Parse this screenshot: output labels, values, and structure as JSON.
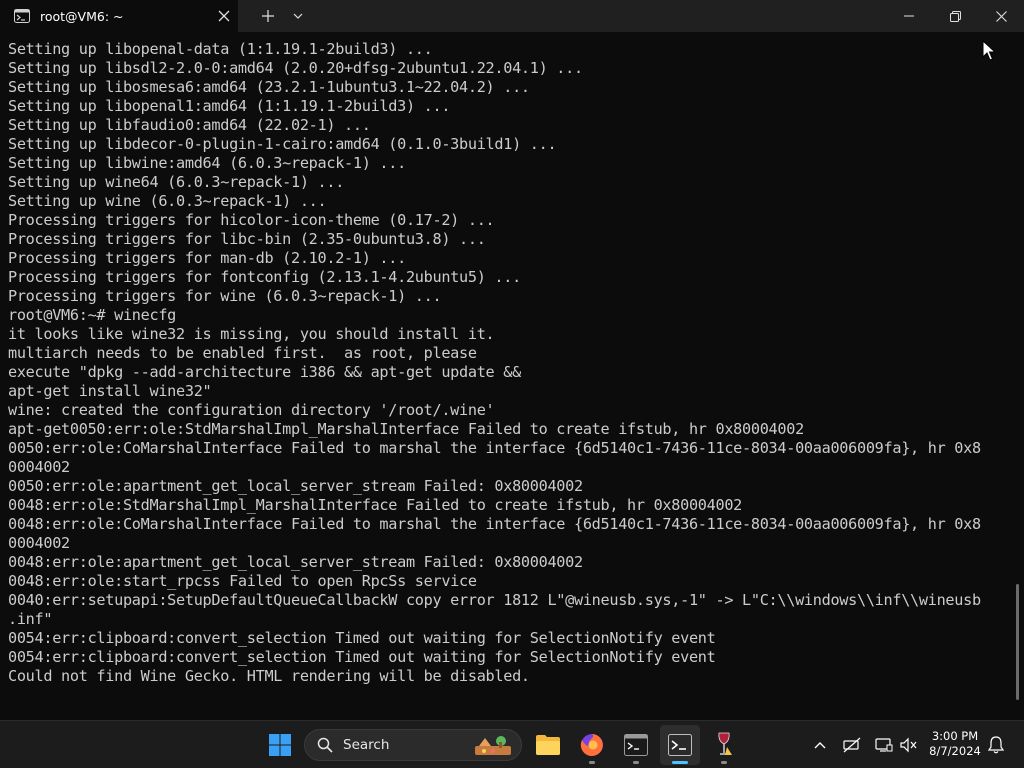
{
  "window": {
    "tab_title": "root@VM6: ~"
  },
  "terminal": {
    "lines": [
      "Setting up libopenal-data (1:1.19.1-2build3) ...",
      "Setting up libsdl2-2.0-0:amd64 (2.0.20+dfsg-2ubuntu1.22.04.1) ...",
      "Setting up libosmesa6:amd64 (23.2.1-1ubuntu3.1~22.04.2) ...",
      "Setting up libopenal1:amd64 (1:1.19.1-2build3) ...",
      "Setting up libfaudio0:amd64 (22.02-1) ...",
      "Setting up libdecor-0-plugin-1-cairo:amd64 (0.1.0-3build1) ...",
      "Setting up libwine:amd64 (6.0.3~repack-1) ...",
      "Setting up wine64 (6.0.3~repack-1) ...",
      "Setting up wine (6.0.3~repack-1) ...",
      "Processing triggers for hicolor-icon-theme (0.17-2) ...",
      "Processing triggers for libc-bin (2.35-0ubuntu3.8) ...",
      "Processing triggers for man-db (2.10.2-1) ...",
      "Processing triggers for fontconfig (2.13.1-4.2ubuntu5) ...",
      "Processing triggers for wine (6.0.3~repack-1) ...",
      "root@VM6:~# winecfg",
      "it looks like wine32 is missing, you should install it.",
      "multiarch needs to be enabled first.  as root, please",
      "execute \"dpkg --add-architecture i386 && apt-get update &&",
      "apt-get install wine32\"",
      "wine: created the configuration directory '/root/.wine'",
      "apt-get0050:err:ole:StdMarshalImpl_MarshalInterface Failed to create ifstub, hr 0x80004002",
      "0050:err:ole:CoMarshalInterface Failed to marshal the interface {6d5140c1-7436-11ce-8034-00aa006009fa}, hr 0x8",
      "0004002",
      "0050:err:ole:apartment_get_local_server_stream Failed: 0x80004002",
      "0048:err:ole:StdMarshalImpl_MarshalInterface Failed to create ifstub, hr 0x80004002",
      "0048:err:ole:CoMarshalInterface Failed to marshal the interface {6d5140c1-7436-11ce-8034-00aa006009fa}, hr 0x8",
      "0004002",
      "0048:err:ole:apartment_get_local_server_stream Failed: 0x80004002",
      "0048:err:ole:start_rpcss Failed to open RpcSs service",
      "0040:err:setupapi:SetupDefaultQueueCallbackW copy error 1812 L\"@wineusb.sys,-1\" -> L\"C:\\\\windows\\\\inf\\\\wineusb",
      ".inf\"",
      "0054:err:clipboard:convert_selection Timed out waiting for SelectionNotify event",
      "0054:err:clipboard:convert_selection Timed out waiting for SelectionNotify event",
      "Could not find Wine Gecko. HTML rendering will be disabled."
    ]
  },
  "taskbar": {
    "search_label": "Search",
    "clock_time": "3:00 PM",
    "clock_date": "8/7/2024"
  },
  "colors": {
    "terminal_bg": "#0c0c0c",
    "terminal_fg": "#cccccc",
    "titlebar_bg": "#202020",
    "taskbar_bg": "#1c1c1c",
    "accent": "#4cc2ff"
  }
}
